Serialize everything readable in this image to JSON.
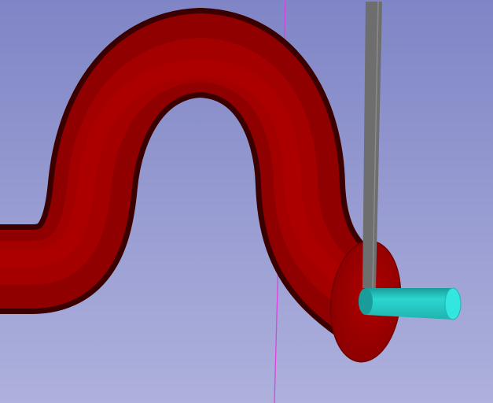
{
  "viewport": {
    "background_top": "#7f85c6",
    "background_bottom": "#aeb1dc"
  },
  "axis_line": {
    "color": "#e040e0"
  },
  "pipe": {
    "color": "#a00000",
    "shadow_color": "#3a0000",
    "highlight_color": "#b40000",
    "end_face_color": "#a80000"
  },
  "pin": {
    "color": "#2bd6d0",
    "end_color": "#34e6e0",
    "shadow_color": "#1a9d9a"
  },
  "plate": {
    "color": "#6e6e6e",
    "edge_color": "#8a8a8a"
  }
}
